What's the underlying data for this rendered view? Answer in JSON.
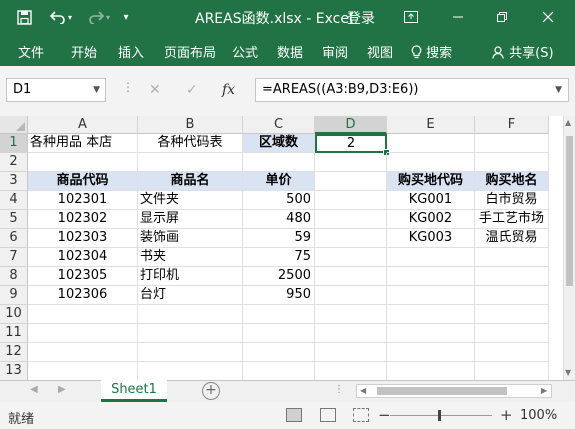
{
  "titlebar": {
    "save_icon": "save-icon",
    "undo_icon": "undo-icon",
    "redo_icon": "redo-icon",
    "title": "AREAS函数.xlsx  -  Excel",
    "login": "登录"
  },
  "ribbon": {
    "tabs": [
      "文件",
      "开始",
      "插入",
      "页面布局",
      "公式",
      "数据",
      "审阅",
      "视图"
    ],
    "search": "搜索",
    "share": "共享(S)"
  },
  "formula_bar": {
    "name_box": "D1",
    "cancel": "✕",
    "enter": "✓",
    "fx": "fx",
    "formula": "=AREAS((A3:B9,D3:E6))"
  },
  "grid": {
    "columns": [
      "A",
      "B",
      "C",
      "D",
      "E",
      "F"
    ],
    "rows": [
      "1",
      "2",
      "3",
      "4",
      "5",
      "6",
      "7",
      "8",
      "9",
      "10",
      "11",
      "12",
      "13"
    ],
    "cells": {
      "A1": "各种用品 本店",
      "B1": "各种代码表",
      "C1": "区域数",
      "D1": "2",
      "A3": "商品代码",
      "B3": "商品名",
      "C3": "单价",
      "E3": "购买地代码",
      "F3": "购买地名",
      "A4": "102301",
      "B4": "文件夹",
      "C4": "500",
      "E4": "KG001",
      "F4": "白市贸易",
      "A5": "102302",
      "B5": "显示屏",
      "C5": "480",
      "E5": "KG002",
      "F5": "手工艺市场",
      "A6": "102303",
      "B6": "装饰画",
      "C6": "59",
      "E6": "KG003",
      "F6": "温氏贸易",
      "A7": "102304",
      "B7": "书夹",
      "C7": "75",
      "A8": "102305",
      "B8": "打印机",
      "C8": "2500",
      "A9": "102306",
      "B9": "台灯",
      "C9": "950"
    }
  },
  "sheets": {
    "active": "Sheet1",
    "add": "+"
  },
  "status": {
    "ready": "就绪",
    "minus": "−",
    "plus": "+",
    "zoom": "100%"
  },
  "colors": {
    "accent": "#217346",
    "header_fill": "#dae3f3"
  }
}
